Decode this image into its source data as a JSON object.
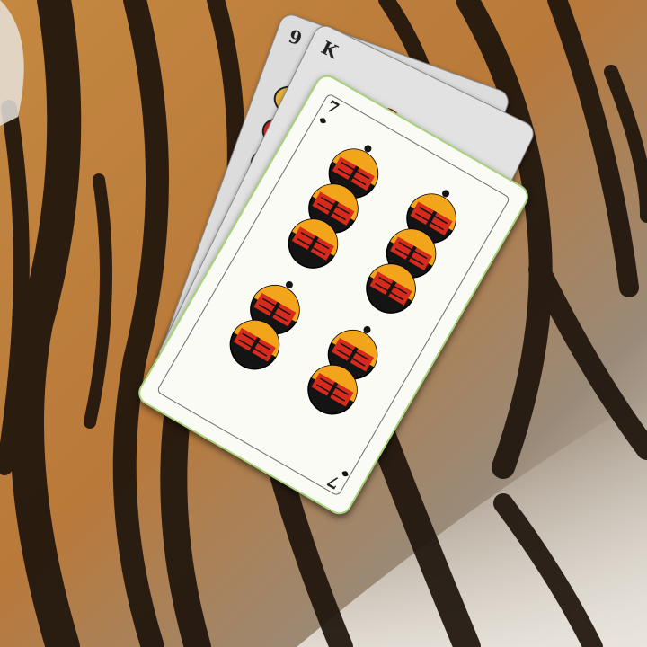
{
  "cards": {
    "back2": {
      "rank": "9",
      "suit_icon": "acorn-icon"
    },
    "back1": {
      "rank": "K",
      "suit_icon": "heart-icon"
    },
    "front": {
      "rank": "7",
      "suit_icon": "bell-icon",
      "pips": 10
    }
  },
  "colors": {
    "bell_red": "#d52a1c",
    "bell_yellow": "#f2a51a",
    "bell_black": "#141414",
    "heart_red": "#e13a1e",
    "fur_orange": "#c98a44",
    "fur_stripe": "#1e140c",
    "fur_white": "#e8e4dc"
  }
}
